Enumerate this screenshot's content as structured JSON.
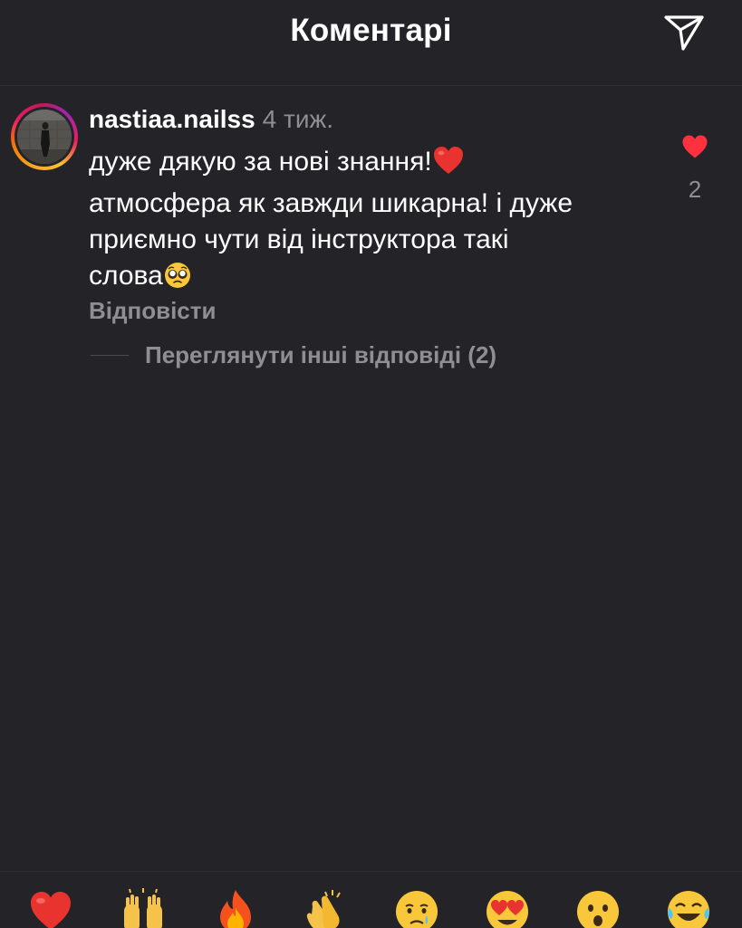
{
  "header": {
    "title": "Коментарі",
    "send_icon": "paper-plane-icon"
  },
  "comment": {
    "username": "nastiaa.nailss",
    "time": "4 тиж.",
    "text_lines": [
      "дуже дякую за нові знання!",
      "атмосфера як завжди шикарна! і дуже",
      "приємно чути від інструктора такі",
      "слова"
    ],
    "inline_emojis": [
      "red-heart-emoji",
      "pleading-face-emoji"
    ],
    "like_icon": "heart-filled-icon",
    "like_color": "#ff3040",
    "like_count": "2",
    "reply_label": "Відповісти",
    "view_replies_label": "Переглянути інші відповіді (2)",
    "avatar_ring_colors": [
      "#f9a825",
      "#e91e63",
      "#9c27b0"
    ]
  },
  "emoji_bar": [
    "red-heart-emoji",
    "raising-hands-emoji",
    "fire-emoji",
    "clapping-hands-emoji",
    "crying-face-emoji",
    "heart-eyes-emoji",
    "surprised-face-emoji",
    "tears-of-joy-emoji"
  ],
  "colors": {
    "background": "#232328",
    "text": "#ffffff",
    "secondary_text": "#8e8e93"
  }
}
